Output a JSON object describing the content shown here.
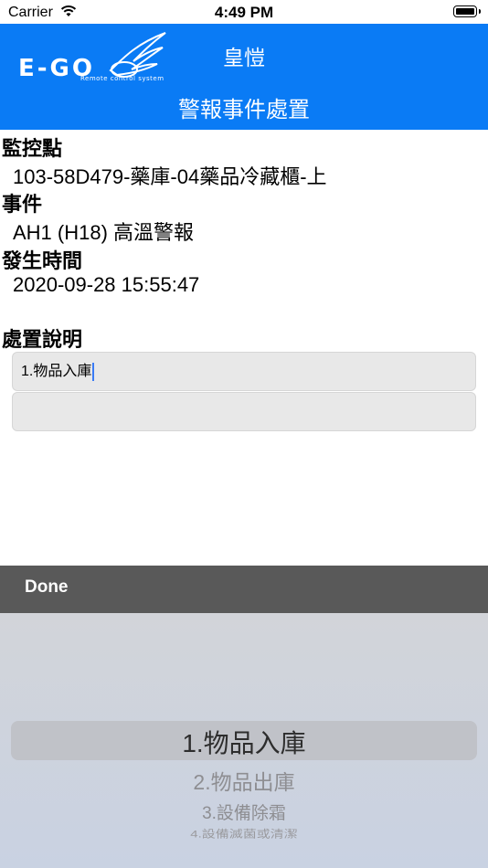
{
  "status_bar": {
    "carrier": "Carrier",
    "time": "4:49 PM"
  },
  "header": {
    "logo_text": "E-GO",
    "logo_subtitle": "Remote control system",
    "app_title": "皇愷",
    "page_title": "警報事件處置"
  },
  "details": {
    "monitor_label": "監控點",
    "monitor_value": "103-58D479-藥庫-04藥品冷藏櫃-上",
    "event_label": "事件",
    "event_value": "AH1 (H18) 高溫警報",
    "time_label": "發生時間",
    "time_value": "2020-09-28 15:55:47",
    "disposal_label": "處置說明"
  },
  "inputs": {
    "disposal_value": "1.物品入庫",
    "remark_value": ""
  },
  "toolbar": {
    "done_label": "Done"
  },
  "picker": {
    "selected": "1.物品入庫",
    "options": [
      "1.物品入庫",
      "2.物品出庫",
      "3.設備除霜",
      "4.設備滅菌或清潔"
    ]
  },
  "colors": {
    "header_bg": "#0a7bf5",
    "toolbar_bg": "#595959",
    "picker_bg": "#d2d4d9"
  }
}
